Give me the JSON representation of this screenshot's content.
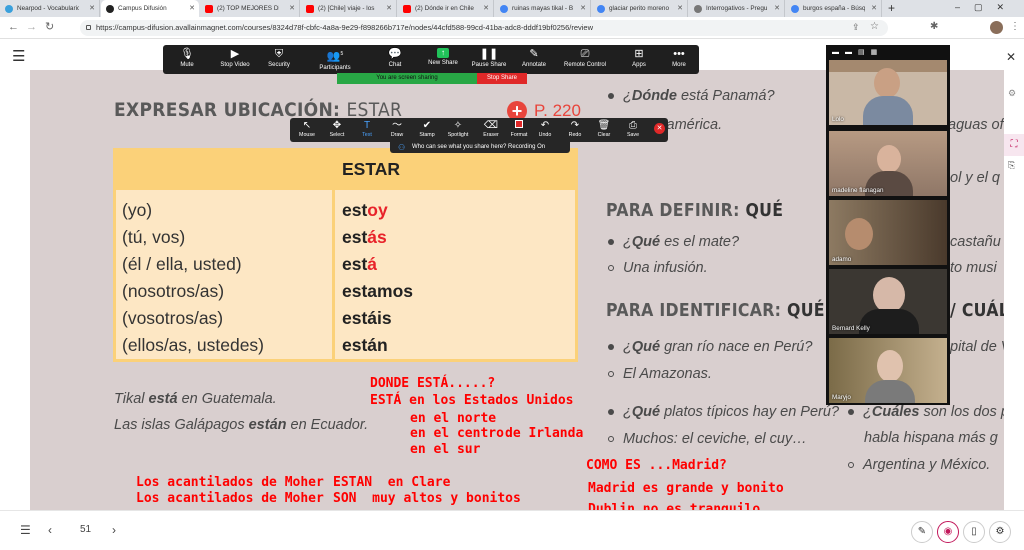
{
  "browser": {
    "tabs": [
      {
        "label": "Nearpod - Vocabulario",
        "color": "#3aa0dc"
      },
      {
        "label": "Campus Difusión",
        "color": "#222222"
      },
      {
        "label": "(2) TOP MEJORES DE",
        "color": "#ff0000"
      },
      {
        "label": "(2) [Chile] viaje - los",
        "color": "#ff0000"
      },
      {
        "label": "(2) Dónde ir en Chile",
        "color": "#ff0000"
      },
      {
        "label": "ruinas mayas tikal - B",
        "color": "#4285f4"
      },
      {
        "label": "glaciar perito moreno",
        "color": "#4285f4"
      },
      {
        "label": "Interrogativos - Pregu",
        "color": "#777777"
      },
      {
        "label": "burgos españa - Búsq",
        "color": "#4285f4"
      }
    ],
    "new_tab": "+",
    "url": "https://campus-difusion.avallainmagnet.com/courses/8324d78f-cbfc-4a8a-9e29-f898266b717e/nodes/44cfd588-99cd-41ba-adc8-dddf19bf0256/review"
  },
  "zoom": {
    "toolbar": [
      {
        "label": "Mute",
        "icon": "microphone-icon"
      },
      {
        "label": "Stop Video",
        "icon": "video-camera-icon"
      },
      {
        "label": "Security",
        "icon": "shield-icon"
      },
      {
        "label": "Participants",
        "icon": "people-icon",
        "badge": "5"
      },
      {
        "label": "Chat",
        "icon": "chat-icon"
      },
      {
        "label": "New Share",
        "icon": "share-arrow-icon"
      },
      {
        "label": "Pause Share",
        "icon": "pause-icon"
      },
      {
        "label": "Annotate",
        "icon": "pencil-icon"
      },
      {
        "label": "Remote Control",
        "icon": "remote-control-icon"
      },
      {
        "label": "Apps",
        "icon": "apps-icon"
      },
      {
        "label": "More",
        "icon": "more-icon"
      }
    ],
    "sharing_status": "You are screen sharing",
    "stop_share": "Stop Share",
    "annotation_tools": [
      {
        "label": "Mouse",
        "icon": "cursor-icon"
      },
      {
        "label": "Select",
        "icon": "move-icon"
      },
      {
        "label": "Text",
        "icon": "text-icon"
      },
      {
        "label": "Draw",
        "icon": "squiggle-icon"
      },
      {
        "label": "Stamp",
        "icon": "check-icon"
      },
      {
        "label": "Spotlight",
        "icon": "wand-icon"
      },
      {
        "label": "Eraser",
        "icon": "eraser-icon"
      },
      {
        "label": "Format",
        "icon": "format-icon"
      },
      {
        "label": "Undo",
        "icon": "undo-icon"
      },
      {
        "label": "Redo",
        "icon": "redo-icon"
      },
      {
        "label": "Clear",
        "icon": "trash-icon"
      },
      {
        "label": "Save",
        "icon": "save-icon"
      }
    ],
    "share_notice": "Who can see what you share here? Recording On",
    "participants": [
      {
        "name": "Lolo",
        "bg": "#c9b8a6"
      },
      {
        "name": "madeline flanagan",
        "bg": "#b79a83"
      },
      {
        "name": "adamo",
        "bg": "#6b5a4a"
      },
      {
        "name": "Bernard Kelly",
        "bg": "#3b3732"
      },
      {
        "name": "Maryjo",
        "bg": "#a99471"
      }
    ]
  },
  "slide": {
    "heading_bold": "EXPRESAR UBICACIÓN:",
    "heading_light": "ESTAR",
    "page_ref": "P. 220",
    "table": {
      "header": "ESTAR",
      "rows": [
        {
          "pronoun": "(yo)",
          "stem": "est",
          "ending": "oy"
        },
        {
          "pronoun": "(tú, vos)",
          "stem": "est",
          "ending": "ás"
        },
        {
          "pronoun": "(él / ella, usted)",
          "stem": "est",
          "ending": "á"
        },
        {
          "pronoun": "(nosotros/as)",
          "stem": "estamos",
          "ending": ""
        },
        {
          "pronoun": "(vosotros/as)",
          "stem": "estáis",
          "ending": ""
        },
        {
          "pronoun": "(ellos/as, ustedes)",
          "stem": "están",
          "ending": ""
        }
      ]
    },
    "examples": [
      {
        "before": "Tikal ",
        "verb": "está",
        "after": " en Guatemala."
      },
      {
        "before": "Las islas Galápagos ",
        "verb": "están",
        "after": " en Ecuador."
      }
    ],
    "q1": {
      "pre": "¿",
      "bold": "Dónde",
      "rest": " está Panamá?"
    },
    "a1": "Centroamérica.",
    "section_definir": {
      "bold": "PARA DEFINIR:",
      "kw": "QUÉ"
    },
    "q2": {
      "pre": "¿",
      "bold": "Qué",
      "rest": " es el mate?"
    },
    "a2": "Una infusión.",
    "section_identificar": {
      "bold": "PARA IDENTIFICAR:",
      "kw": "QUÉ + SU",
      "tail": "/ CUÁL"
    },
    "q3": {
      "pre": "¿",
      "bold": "Qué",
      "rest": " gran río nace en Perú?"
    },
    "a3": "El Amazonas.",
    "q4": {
      "pre": "¿",
      "bold": "Qué",
      "rest": " platos típicos hay en Perú?"
    },
    "a4": "Muchos: el ceviche, el cuy…",
    "right_col": {
      "r1": "aguas of",
      "r2": "ol y el q",
      "r3": "castañu",
      "r4": "to musi",
      "r5": "pital de V",
      "q5": {
        "pre": "¿",
        "bold": "Cuáles",
        "rest": " son los dos p"
      },
      "q5b": "habla hispana más g",
      "a5": "Argentina y México."
    },
    "annotations": {
      "donde": "DONDE ESTÁ.....?",
      "eeuu": "ESTÁ en los Estados Unidos",
      "norte": "en el norte",
      "centro": "en el centro",
      "irlanda": "de Irlanda",
      "sur": "en el sur",
      "moher1": "Los acantilados de Moher",
      "moher2": "Los acantilados de Moher",
      "clare": "ESTAN  en Clare",
      "son": "SON  muy altos y bonitos",
      "como": "COMO ES ...Madrid?",
      "madrid": "Madrid es grande y bonito",
      "dublin": "Dublin no es tranquilo"
    }
  },
  "bottom": {
    "page_number": "51"
  }
}
